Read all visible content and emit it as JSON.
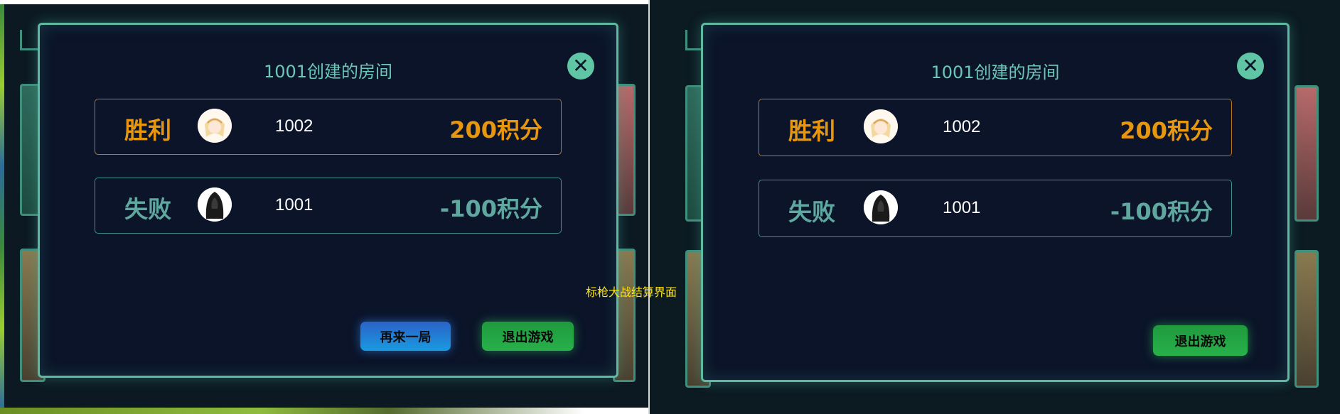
{
  "caption": "标枪大战结算界面",
  "colors": {
    "win": "#e6960f",
    "lose": "#5fa8a0",
    "title": "#6cc7b8",
    "dialog_border": "#5fb8a0"
  },
  "screens": [
    {
      "dialog": {
        "title": "1001创建的房间",
        "close_icon": "close-icon",
        "results": [
          {
            "result": "胜利",
            "player_id": "1002",
            "score": "200积分",
            "avatar": "anime-girl-avatar"
          },
          {
            "result": "失败",
            "player_id": "1001",
            "score": "-100积分",
            "avatar": "hooded-figure-avatar"
          }
        ],
        "buttons": {
          "replay": "再来一局",
          "exit": "退出游戏"
        }
      }
    },
    {
      "dialog": {
        "title": "1001创建的房间",
        "close_icon": "close-icon",
        "results": [
          {
            "result": "胜利",
            "player_id": "1002",
            "score": "200积分",
            "avatar": "anime-girl-avatar"
          },
          {
            "result": "失败",
            "player_id": "1001",
            "score": "-100积分",
            "avatar": "hooded-figure-avatar"
          }
        ],
        "buttons": {
          "exit": "退出游戏"
        }
      }
    }
  ]
}
